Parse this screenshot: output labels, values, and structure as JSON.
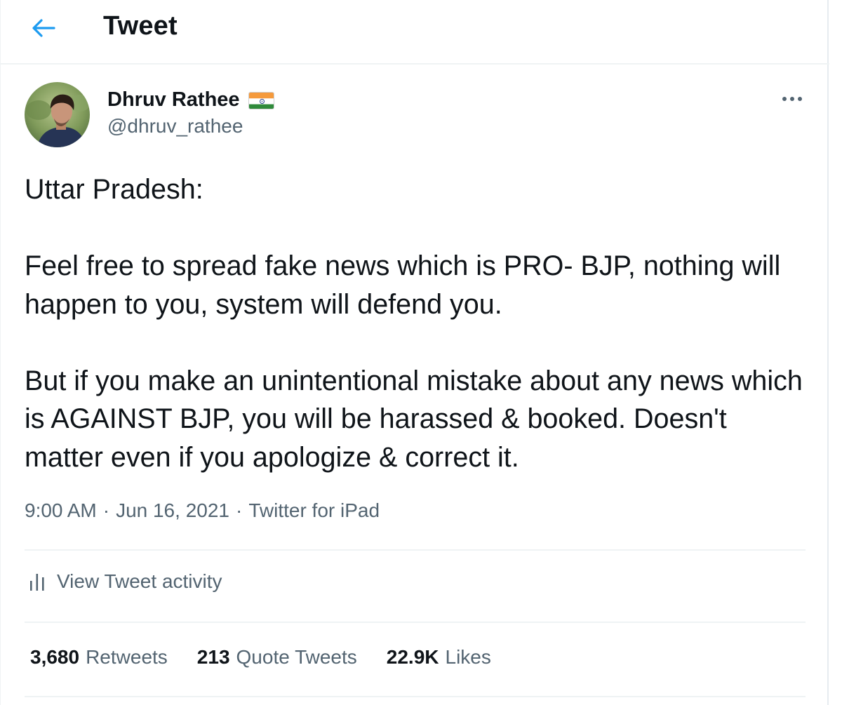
{
  "header": {
    "title": "Tweet",
    "back_icon": "arrow-left-icon",
    "accent_color": "#1d9bf0"
  },
  "author": {
    "name": "Dhruv Rathee",
    "handle": "@dhruv_rathee",
    "flag_icon": "india-flag-icon",
    "avatar_icon": "avatar-photo"
  },
  "more_icon": "more-horizontal-icon",
  "tweet": {
    "paragraphs": [
      "Uttar Pradesh:",
      "Feel free to spread fake news which is PRO- BJP, nothing will happen to you, system will defend you.",
      "But if you make an unintentional mistake about any news which is AGAINST BJP, you will be harassed & booked. Doesn't matter even if you apologize & correct it."
    ]
  },
  "meta": {
    "time": "9:00 AM",
    "separator": "·",
    "date": "Jun 16, 2021",
    "source": "Twitter for iPad"
  },
  "activity": {
    "icon": "bar-chart-icon",
    "label": "View Tweet activity"
  },
  "stats": [
    {
      "count": "3,680",
      "label": "Retweets"
    },
    {
      "count": "213",
      "label": "Quote Tweets"
    },
    {
      "count": "22.9K",
      "label": "Likes"
    }
  ]
}
